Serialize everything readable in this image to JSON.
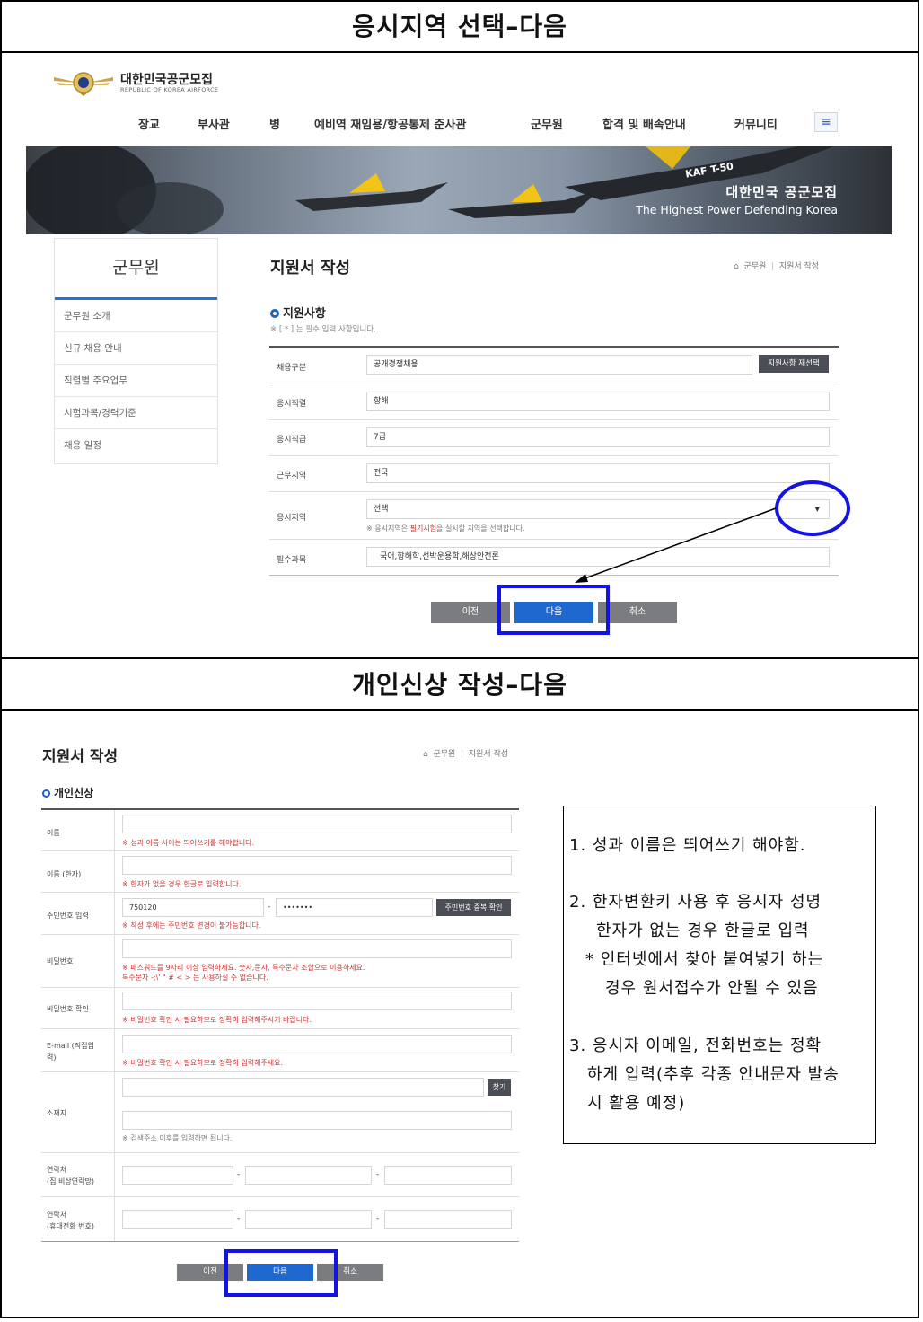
{
  "section1": {
    "title": "응시지역 선택–다음"
  },
  "section2": {
    "title": "개인신상 작성–다음"
  },
  "header": {
    "logo_title": "대한민국공군모집",
    "logo_sub": "REPUBLIC OF KOREA AIRFORCE",
    "nav": [
      "장교",
      "부사관",
      "병",
      "예비역 재임용/항공통제 준사관",
      "군무원",
      "합격 및 배속안내",
      "커뮤니티"
    ],
    "menu_icon": "≡",
    "banner_title": "대한민국 공군모집",
    "banner_sub": "The Highest Power Defending Korea",
    "banner_jet_tag": "KAF T-50"
  },
  "sidebar": {
    "title": "군무원",
    "items": [
      "군무원 소개",
      "신규 채용 안내",
      "직렬별 주요업무",
      "시험과목/경력기준",
      "채용 일정"
    ]
  },
  "apply": {
    "title": "지원서 작성",
    "breadcrumb": [
      "군무원",
      "지원서 작성"
    ],
    "section": "지원사항",
    "required_note": "※ [ * ] 는 필수 입력 사항입니다.",
    "rows": [
      {
        "label": "채용구분",
        "value": "공개경쟁채용"
      },
      {
        "label": "응시직렬",
        "value": "항해"
      },
      {
        "label": "응시직급",
        "value": "7급"
      },
      {
        "label": "근무지역",
        "value": "전국"
      },
      {
        "label": "응시지역",
        "value": "선택"
      },
      {
        "label": "필수과목",
        "value": "국어,항해학,선박운용학,해상안전론"
      }
    ],
    "reselect_button": "지원사항 재선택",
    "region_note_a": "※ 응시지역은 ",
    "region_note_b": "필기시험",
    "region_note_c": "을 실시할 지역을 선택합니다.",
    "select_arrow": "▼",
    "buttons": {
      "prev": "이전",
      "next": "다음",
      "cancel": "취소"
    }
  },
  "personal": {
    "title": "지원서 작성",
    "breadcrumb": [
      "군무원",
      "지원서 작성"
    ],
    "section": "개인신상",
    "name_label": "이름",
    "name_help": "※ 성과 이름 사이는 띄어쓰기를 해야합니다.",
    "hanja_label": "이름 (한자)",
    "hanja_help": "※ 한자가 없을 경우 한글로 입력합니다.",
    "rrn_label": "주민번호 입력",
    "rrn_front": "750120",
    "rrn_dash": "-",
    "rrn_back": "•••••••",
    "rrn_button": "주민번호 중복 확인",
    "rrn_help": "※ 작성 후에는 주민번호 변경이 불가능합니다.",
    "pw_label": "비밀번호",
    "pw_help1": "※ 패스워드를 9자리 이상 입력하세요. 숫자,문자, 특수문자 조합으로 이용하세요.",
    "pw_help2": "특수문자 -;\\' \" # < > 는 사용하실 수 없습니다.",
    "pw2_label": "비밀번호 확인",
    "pw2_help": "※ 비밀번호 확인 시 필요하므로 정확히 입력해주시기 바랍니다.",
    "email_label1": "E-mail (직접입",
    "email_label2": "력)",
    "email_help": "※ 비밀번호 확인 시 필요하므로 정확히 입력해주세요.",
    "addr_label": "소재지",
    "addr_button": "찾기",
    "addr_help": "※ 검색주소 이후를 입력하면 됩니다.",
    "phone_label1": "연락처",
    "phone_label1_sub": "(집 비상연락망)",
    "phone_label2": "연락처",
    "phone_label2_sub": "(휴대전화 번호)",
    "dash": "-",
    "buttons": {
      "prev": "이전",
      "next": "다음",
      "cancel": "취소"
    }
  },
  "info": {
    "line1": "1. 성과 이름은 띄어쓰기 해야함.",
    "line2a": "2. 한자변환키 사용 후 응시자 성명",
    "line2b": "한자가 없는 경우 한글로 입력",
    "line2c": "* 인터넷에서 찾아 붙여넣기 하는",
    "line2d": "경우 원서접수가 안될 수 있음",
    "line3a": "3. 응시자 이메일, 전화번호는 정확",
    "line3b": "하게 입력(추후 각종 안내문자 발송",
    "line3c": "시 활용 예정)"
  },
  "colors": {
    "accent": "#1f68d0",
    "highlight": "#1313e6",
    "helper": "#c33333"
  }
}
